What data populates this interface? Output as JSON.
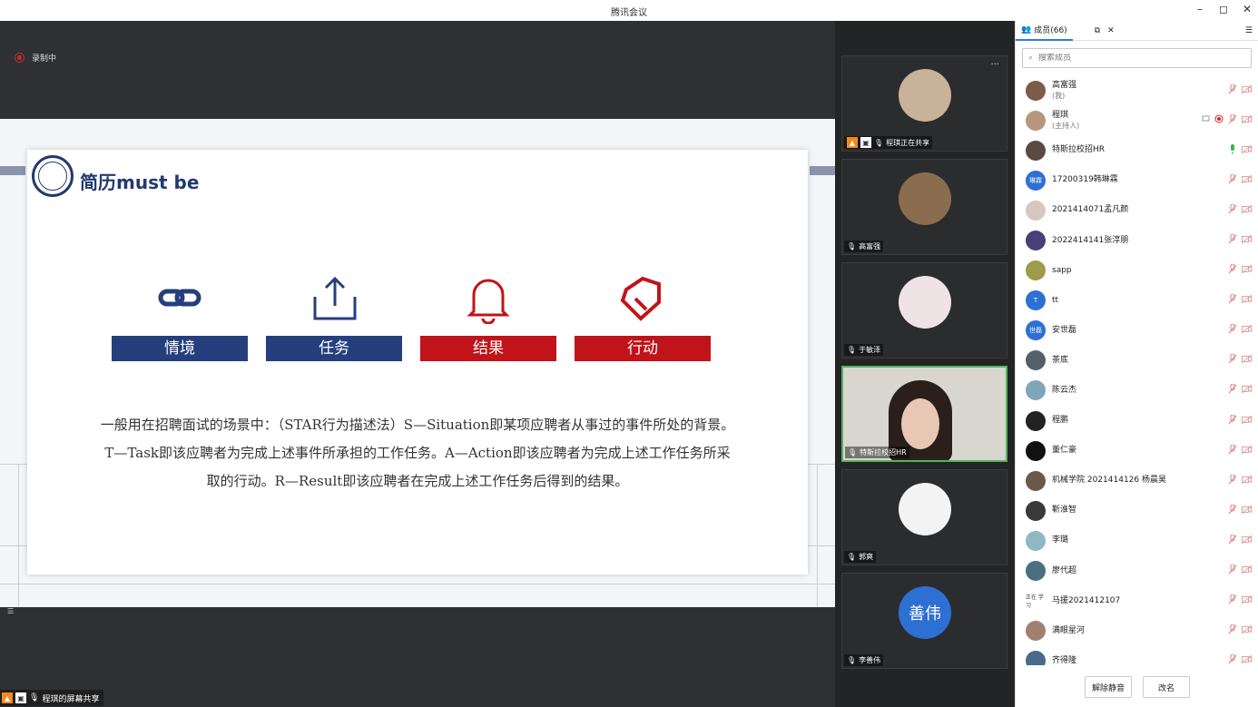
{
  "window": {
    "title": "腾讯会议",
    "controls": [
      "–",
      "◻",
      "✕"
    ]
  },
  "stage": {
    "recording_label": "录制中",
    "slide": {
      "title": "简历must be",
      "star_items": [
        {
          "label": "情境",
          "color": "#253f7d",
          "icon": "link-icon"
        },
        {
          "label": "任务",
          "color": "#253f7d",
          "icon": "upload-icon"
        },
        {
          "label": "结果",
          "color": "#c0141a",
          "icon": "bell-icon"
        },
        {
          "label": "行动",
          "color": "#c0141a",
          "icon": "tag-icon"
        }
      ],
      "body_lines": [
        "一般用在招聘面试的场景中：（STAR行为描述法）S—Situation即某项应聘者从事过的事件所处的背景。",
        "T—Task即该应聘者为完成上述事件所承担的工作任务。A—Action即该应聘者为完成上述工作任务所采",
        "取的行动。R—Result即该应聘者在完成上述工作任务后得到的结果。"
      ]
    },
    "share_label": "程琪的屏幕共享"
  },
  "video_tiles": [
    {
      "name": "程琪正在共享",
      "avatar_color": "#c9b29a",
      "sharing": true
    },
    {
      "name": "高富强",
      "avatar_color": "#8a6d4f"
    },
    {
      "name": "于敏泽",
      "avatar_color": "#efe3e6"
    },
    {
      "name": "特斯拉校招HR",
      "avatar_color": "#d9d6d0",
      "active": true
    },
    {
      "name": "郭爽",
      "avatar_color": "#f3f3f3"
    },
    {
      "name": "李善伟",
      "avatar_text": "善伟",
      "avatar_color": "#2e6fd3"
    }
  ],
  "panel": {
    "tab_members": "成员(66)",
    "search_placeholder": "搜索成员",
    "members": [
      {
        "name": "高富强",
        "sub": "(我)",
        "avatar_color": "#7d5a4a",
        "mic": "muted"
      },
      {
        "name": "程琪",
        "sub": "(主持人)",
        "avatar_color": "#b8967c",
        "mic": "muted",
        "host": true
      },
      {
        "name": "特斯拉校招HR",
        "avatar_color": "#5a4a44",
        "mic": "on"
      },
      {
        "name": "17200319韩琳霖",
        "avatar_text": "琳霖",
        "avatar_color": "#2e6fd3",
        "mic": "muted"
      },
      {
        "name": "2021414071孟凡颜",
        "avatar_color": "#d6c7c0",
        "mic": "muted"
      },
      {
        "name": "2022414141张淳朋",
        "avatar_color": "#4a3f78",
        "mic": "muted"
      },
      {
        "name": "sapp",
        "avatar_color": "#9e9b4a",
        "mic": "muted"
      },
      {
        "name": "tt",
        "avatar_text": "T",
        "avatar_color": "#2e6fd3",
        "mic": "muted"
      },
      {
        "name": "安世磊",
        "avatar_text": "世磊",
        "avatar_color": "#2e6fd3",
        "mic": "muted"
      },
      {
        "name": "茶底",
        "avatar_color": "#55606a",
        "mic": "muted"
      },
      {
        "name": "陈云杰",
        "avatar_color": "#7fa6b8",
        "mic": "muted"
      },
      {
        "name": "程鹏",
        "avatar_color": "#222222",
        "mic": "muted"
      },
      {
        "name": "董仁豪",
        "avatar_color": "#111111",
        "mic": "muted"
      },
      {
        "name": "机械学院 2021414126 杨晨昊",
        "avatar_color": "#6b5a4a",
        "mic": "muted"
      },
      {
        "name": "靳淮智",
        "avatar_color": "#3a3a3a",
        "mic": "muted"
      },
      {
        "name": "李璐",
        "avatar_color": "#8fb8c4",
        "mic": "muted"
      },
      {
        "name": "廖代超",
        "avatar_color": "#4a7080",
        "mic": "muted"
      },
      {
        "name": "马援2021412107",
        "avatar_text": "正在 学习",
        "avatar_color": "#ffffff",
        "mic": "muted"
      },
      {
        "name": "满眼星河",
        "avatar_color": "#a08070",
        "mic": "muted"
      },
      {
        "name": "齐得隆",
        "avatar_color": "#4a6a8a",
        "mic": "muted"
      }
    ],
    "btn_unmute": "解除静音",
    "btn_rename": "改名"
  }
}
